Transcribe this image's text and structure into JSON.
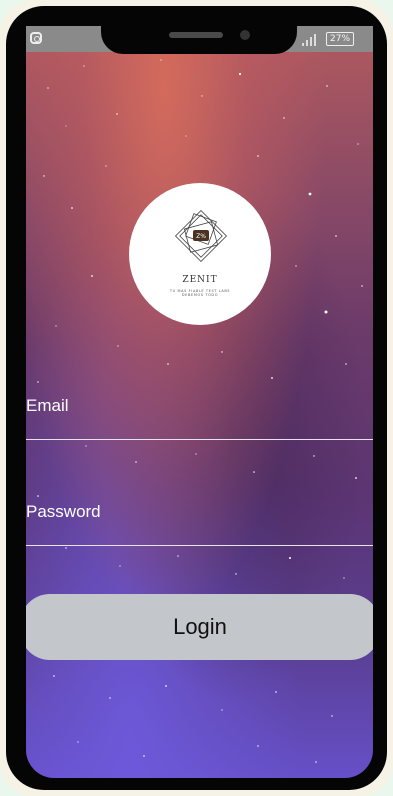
{
  "status_bar": {
    "battery_label": "27%",
    "icons": [
      "camera-icon",
      "signal-icon",
      "battery-icon"
    ]
  },
  "logo": {
    "mark_text": "Z%",
    "name": "ZENIT",
    "tagline_1": "TU MAS FIABLE TEST LABS",
    "tagline_2": "DEBEMOS TODO"
  },
  "form": {
    "email_label": "Email",
    "email_value": "",
    "password_label": "Password",
    "password_value": "",
    "login_label": "Login"
  },
  "colors": {
    "button_bg": "#c3c6ca",
    "field_line": "#e8e4ee",
    "status_bar_bg": "#8a8a8a"
  }
}
